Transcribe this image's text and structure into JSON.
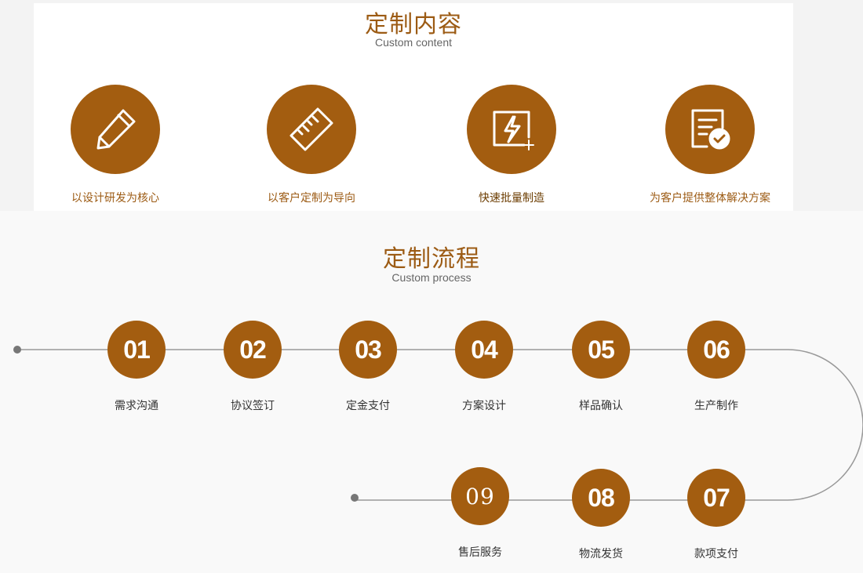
{
  "content": {
    "title": "定制内容",
    "subtitle": "Custom content",
    "items": [
      {
        "icon": "pencil-icon",
        "label": "以设计研发为核心"
      },
      {
        "icon": "ruler-icon",
        "label": "以客户定制为导向"
      },
      {
        "icon": "lightning-icon",
        "label": "快速批量制造"
      },
      {
        "icon": "checklist-icon",
        "label": "为客户提供整体解决方案"
      }
    ]
  },
  "process": {
    "title": "定制流程",
    "subtitle": "Custom process",
    "steps": [
      {
        "num": "01",
        "label": "需求沟通"
      },
      {
        "num": "02",
        "label": "协议签订"
      },
      {
        "num": "03",
        "label": "定金支付"
      },
      {
        "num": "04",
        "label": "方案设计"
      },
      {
        "num": "05",
        "label": "样品确认"
      },
      {
        "num": "06",
        "label": "生产制作"
      },
      {
        "num": "07",
        "label": "款项支付"
      },
      {
        "num": "08",
        "label": "物流发货"
      },
      {
        "num": "09",
        "label": "售后服务"
      }
    ]
  },
  "colors": {
    "accent": "#a35d10",
    "title": "#9c5b14",
    "line": "#999999"
  }
}
